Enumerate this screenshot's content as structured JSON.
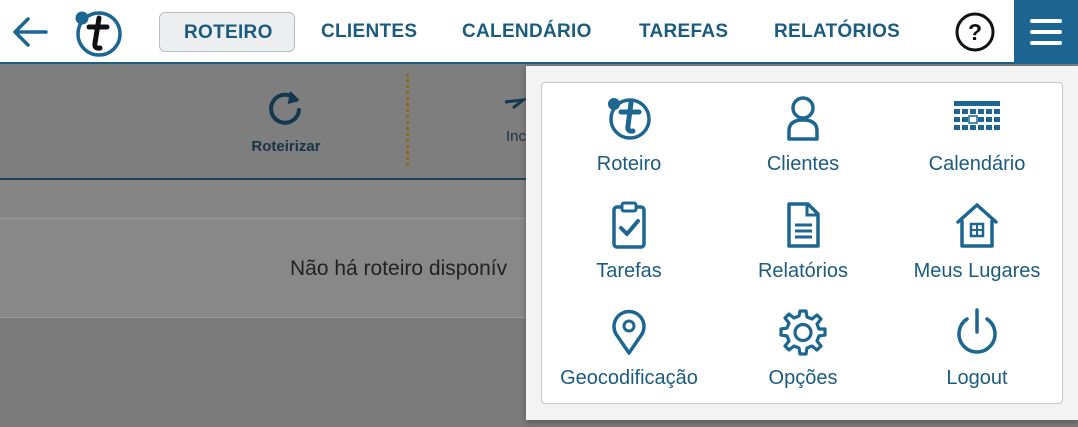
{
  "nav": {
    "tabs": [
      {
        "label": "ROTEIRO",
        "active": true
      },
      {
        "label": "CLIENTES"
      },
      {
        "label": "CALENDÁRIO"
      },
      {
        "label": "TAREFAS"
      },
      {
        "label": "RELATÓRIOS"
      }
    ],
    "help_icon": "question-circle-icon",
    "menu_icon": "hamburger-icon",
    "back_icon": "arrow-left-icon",
    "logo": "t-logo"
  },
  "toolbar": {
    "roteirizar_label": "Roteirizar",
    "partial_label": "Inc"
  },
  "content": {
    "empty_message": "Não há roteiro disponív"
  },
  "menu": {
    "items": [
      {
        "label": "Roteiro",
        "icon": "t-logo-icon"
      },
      {
        "label": "Clientes",
        "icon": "person-icon"
      },
      {
        "label": "Calendário",
        "icon": "calendar-grid-icon"
      },
      {
        "label": "Tarefas",
        "icon": "clipboard-check-icon"
      },
      {
        "label": "Relatórios",
        "icon": "document-icon"
      },
      {
        "label": "Meus Lugares",
        "icon": "house-icon"
      },
      {
        "label": "Geocodificação",
        "icon": "map-pin-icon"
      },
      {
        "label": "Opções",
        "icon": "gear-icon"
      },
      {
        "label": "Logout",
        "icon": "power-icon"
      }
    ]
  },
  "colors": {
    "accent": "#1d6691",
    "text_accent": "#1b5b80",
    "overlay_gray": "#7b7b7b"
  }
}
